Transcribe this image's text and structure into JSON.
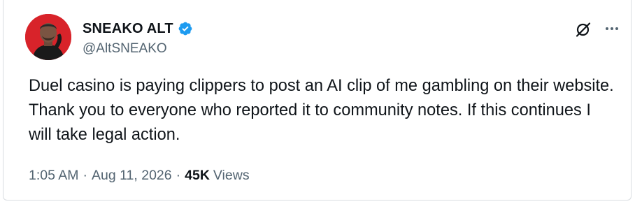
{
  "author": {
    "display_name": "SNEAKO ALT",
    "handle": "@AltSNEAKO",
    "verified": true,
    "avatar_icon": "profile-photo"
  },
  "header_icons": {
    "grok": "grok-icon",
    "more": "more-options-icon"
  },
  "tweet": {
    "text": "Duel casino is paying clippers to post an AI clip of me gambling on their website. Thank you to everyone who reported it to community notes. If this continues I will take legal action."
  },
  "meta": {
    "time": "1:05 AM",
    "separator": "·",
    "date": "Aug 11, 2026",
    "views_count": "45K",
    "views_label": "Views"
  },
  "colors": {
    "text_primary": "#0f1419",
    "text_secondary": "#536471",
    "verified_blue": "#1d9bf0",
    "border": "#d9dde1"
  }
}
